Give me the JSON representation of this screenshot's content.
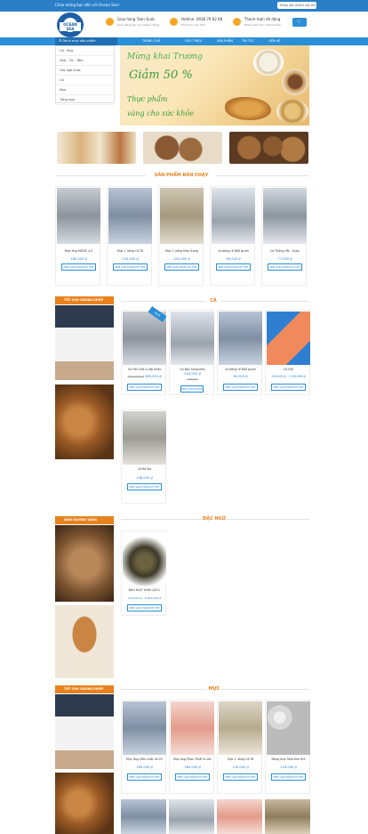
{
  "topbar": {
    "left_text": "Chào mừng bạn đến với Ocean Sea!",
    "search_placeholder": "Nhập sản phẩm cần tìm"
  },
  "header": {
    "logo_text": "OCEAN SEA",
    "items": [
      {
        "title": "Giao hàng Toàn Quốc",
        "sub": "Giao hàng tận nơi nhanh chóng"
      },
      {
        "title": "Hotline: 0938 79 82 88",
        "sub": "Hỗ trợ tư vấn 24/7"
      },
      {
        "title": "Thanh toán dễ dàng",
        "sub": "Nhiều hình thức thanh toán"
      }
    ],
    "cart_icon": "cart-icon"
  },
  "nav": {
    "category_label": "Danh mục sản phẩm",
    "items": [
      "TRANG CHỦ",
      "GIỚI THIỆU",
      "SẢN PHẨM",
      "TIN TỨC",
      "LIÊN HỆ"
    ]
  },
  "categories": [
    "Cá - Mực",
    "Ghẹ - Ốc - Tôm",
    "Các loại khác",
    "Cá",
    "Mực",
    "Tổng hợp"
  ],
  "banner": {
    "line1": "Mừng khai Trương",
    "line2": "Giảm 50 %",
    "line3": "Thực phẩm",
    "line4": "vàng cho sức khỏe"
  },
  "sections": {
    "best": "SẢN PHẨM BÁN CHẠY",
    "ca": "CÁ",
    "dacngu": "ĐẶC NGỮ",
    "muc": "MỰC"
  },
  "side_labels": {
    "s1": "TỐT CHO XƯƠNG KHỚP",
    "s2": "DINH DƯỠNG VÀNG",
    "s3": "TỐT CHO XƯƠNG KHỚP"
  },
  "button_label": "XEM SẢN PHẨM/CHI TIẾT",
  "best_products": [
    {
      "name": "Mực ống MODE 4,5",
      "price": "180,000 ₫"
    },
    {
      "name": "Mực 1 nắng Cô Tô",
      "price": "130,000 ₫"
    },
    {
      "name": "Mực 1 nắng Nha Trang",
      "price": "220,000 ₫"
    },
    {
      "name": "cá bống rề 800 gram",
      "price": "60,000 ₫"
    },
    {
      "name": "Cá Thông VN - Xuân",
      "price": "77,000 ₫"
    }
  ],
  "ca_products": [
    {
      "name": "Cá Hồi Chờ n.cấp khẩu",
      "old": "400,000 ₫",
      "price": "380,000 ₫"
    },
    {
      "name": "Cá Bạc Song-tôm",
      "old": "220,000",
      "price": "400,000 ₫"
    },
    {
      "name": "cá bống rề 800 gram",
      "old": "",
      "price": "60,000 ₫"
    },
    {
      "name": "CÁ HỒI",
      "old": "",
      "price": "500,000 ₫ – 1,000,000 ₫"
    },
    {
      "name": "Cá Bò Da",
      "old": "",
      "price": "138,000 ₫"
    }
  ],
  "dacngu_products": [
    {
      "name": "BÀO NGƯ HÀN QUỐC",
      "price": "270,000 ₫ – 8,000,000 ₫"
    }
  ],
  "muc_products": [
    {
      "name": "Mực ống Siêu chất 18-22",
      "price": "160,000 ₫"
    },
    {
      "name": "Mực ống Phan Thiết 8-10c",
      "price": "180,000 ₫"
    },
    {
      "name": "Mực 1 nắng Cô Tô",
      "price": "130,000 ₫"
    },
    {
      "name": "Bông mực Nha tinh 8/9",
      "price": "118,000 ₫"
    }
  ],
  "ca_badge": "SALE"
}
